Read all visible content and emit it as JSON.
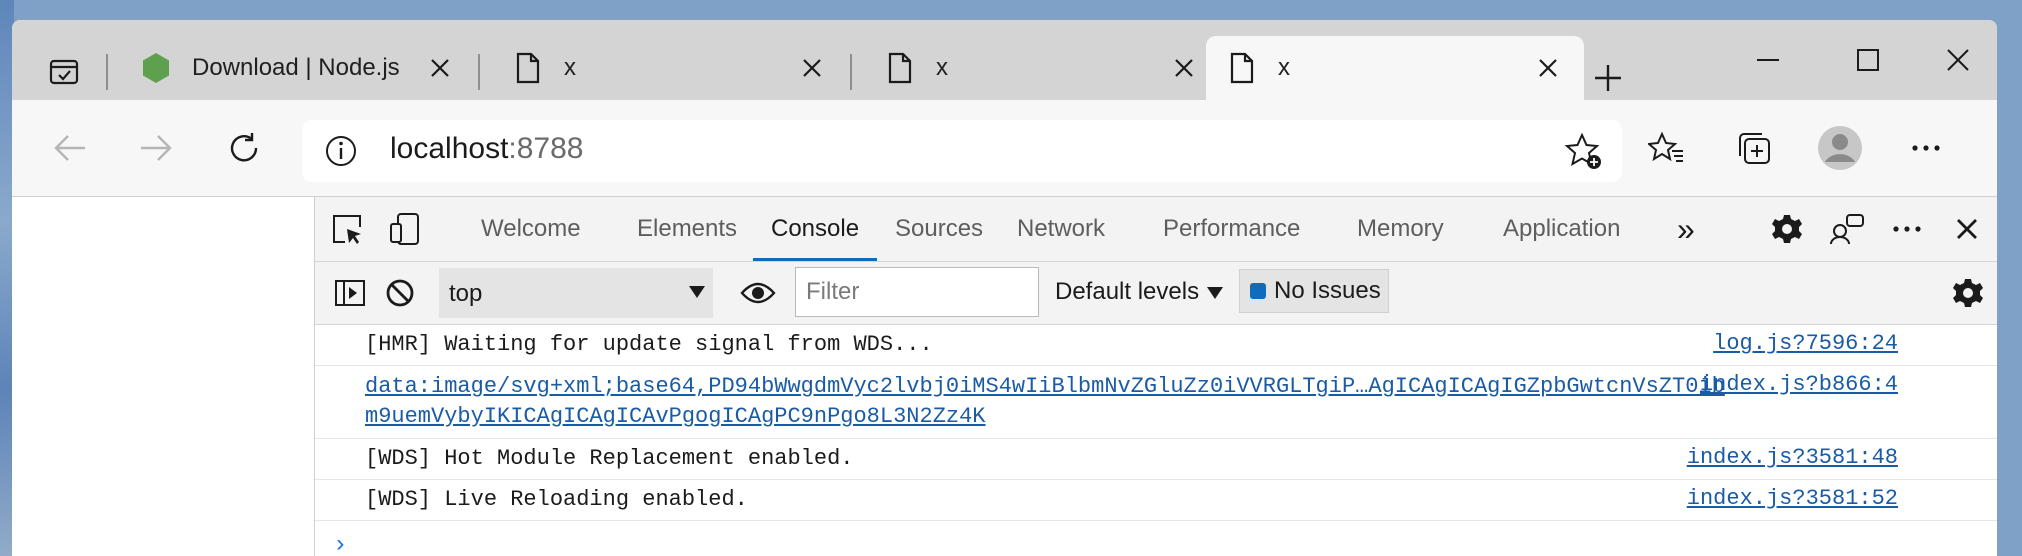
{
  "tabs": [
    {
      "title": "Download | Node.js",
      "favicon": "nodejs-icon",
      "active": false
    },
    {
      "title": "x",
      "favicon": "page-icon",
      "active": false
    },
    {
      "title": "x",
      "favicon": "page-icon",
      "active": false
    },
    {
      "title": "x",
      "favicon": "page-icon",
      "active": true
    }
  ],
  "address": {
    "host": "localhost",
    "port": ":8788"
  },
  "devtools": {
    "tabs": [
      "Welcome",
      "Elements",
      "Console",
      "Sources",
      "Network",
      "Performance",
      "Memory",
      "Application"
    ],
    "active_tab": "Console",
    "more": "»"
  },
  "console": {
    "context": "top",
    "filter_placeholder": "Filter",
    "levels": "Default levels",
    "issues": "No Issues",
    "messages": [
      {
        "text": "[HMR] Waiting for update signal from WDS...",
        "source": "log.js?7596:24",
        "link": false
      },
      {
        "text": "data:image/svg+xml;base64,PD94bWwgdmVyc2lvbj0iMS4wIiBlbmNvZGluZz0iVVRGLTgiP…AgICAgICAgIGZpbGwtcnVsZT0ibm9uemVybyIKICAgICAgICAvPgogICAgPC9nPgo8L3N2Zz4K",
        "source": "index.js?b866:4",
        "link": true
      },
      {
        "text": "[WDS] Hot Module Replacement enabled.",
        "source": "index.js?3581:48",
        "link": false
      },
      {
        "text": "[WDS] Live Reloading enabled.",
        "source": "index.js?3581:52",
        "link": false
      }
    ],
    "prompt": "›"
  },
  "colors": {
    "accent": "#0f6cbd",
    "link": "#1a5ba6",
    "node_green": "#5fa04e"
  }
}
